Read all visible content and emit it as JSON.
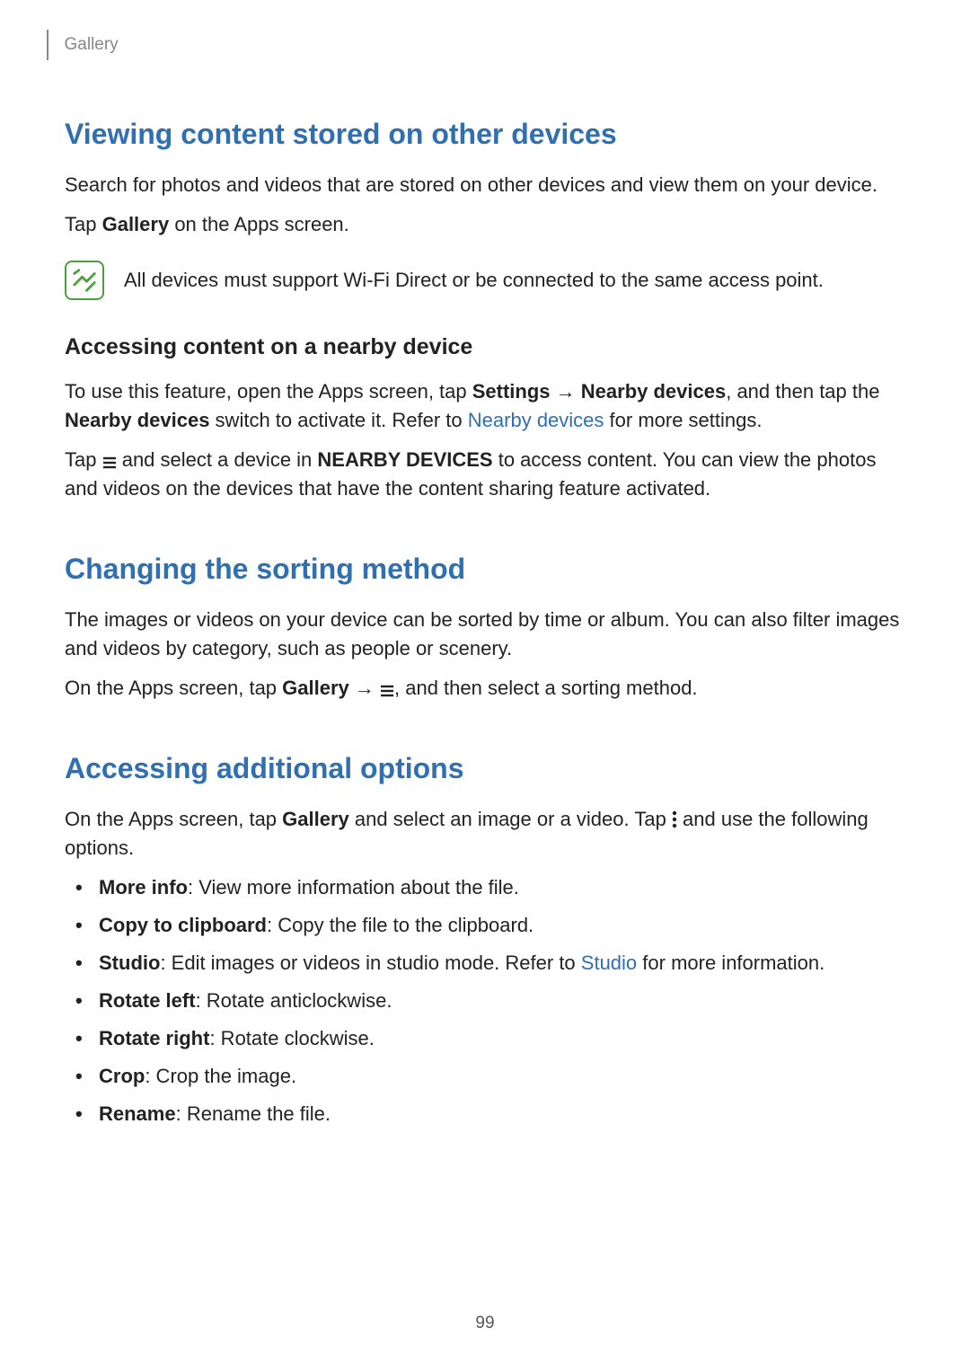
{
  "header": {
    "section": "Gallery"
  },
  "s1": {
    "title": "Viewing content stored on other devices",
    "p1_a": "Search for photos and videos that are stored on other devices and view them on your device.",
    "p2_a": "Tap ",
    "p2_b": "Gallery",
    "p2_c": " on the Apps screen.",
    "note": "All devices must support Wi-Fi Direct or be connected to the same access point.",
    "sub1": {
      "title": "Accessing content on a nearby device",
      "p1_a": "To use this feature, open the Apps screen, tap ",
      "p1_b": "Settings",
      "p1_c": " → ",
      "p1_d": "Nearby devices",
      "p1_e": ", and then tap the ",
      "p1_f": "Nearby devices",
      "p1_g": " switch to activate it. Refer to ",
      "p1_link": "Nearby devices",
      "p1_h": " for more settings.",
      "p2_a": "Tap ",
      "p2_b": " and select a device in ",
      "p2_c": "NEARBY DEVICES",
      "p2_d": " to access content. You can view the photos and videos on the devices that have the content sharing feature activated."
    }
  },
  "s2": {
    "title": "Changing the sorting method",
    "p1": "The images or videos on your device can be sorted by time or album. You can also filter images and videos by category, such as people or scenery.",
    "p2_a": "On the Apps screen, tap ",
    "p2_b": "Gallery",
    "p2_c": " → ",
    "p2_d": ", and then select a sorting method."
  },
  "s3": {
    "title": "Accessing additional options",
    "p1_a": "On the Apps screen, tap ",
    "p1_b": "Gallery",
    "p1_c": " and select an image or a video. Tap ",
    "p1_d": " and use the following options.",
    "items": [
      {
        "b": "More info",
        "t": ": View more information about the file."
      },
      {
        "b": "Copy to clipboard",
        "t": ": Copy the file to the clipboard."
      },
      {
        "b": "Studio",
        "t_a": ": Edit images or videos in studio mode. Refer to ",
        "link": "Studio",
        "t_b": " for more information."
      },
      {
        "b": "Rotate left",
        "t": ": Rotate anticlockwise."
      },
      {
        "b": "Rotate right",
        "t": ": Rotate clockwise."
      },
      {
        "b": "Crop",
        "t": ": Crop the image."
      },
      {
        "b": "Rename",
        "t": ": Rename the file."
      }
    ]
  },
  "page_number": "99"
}
